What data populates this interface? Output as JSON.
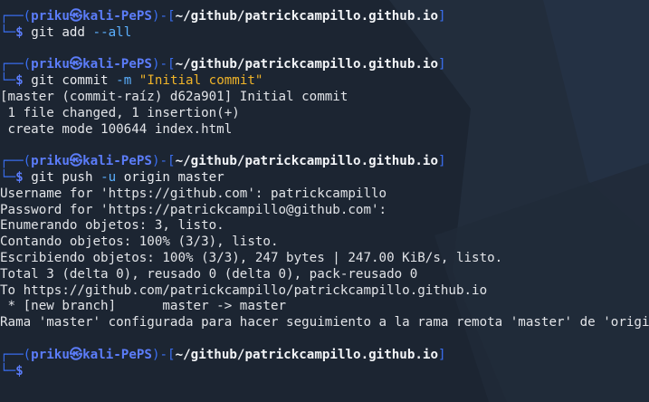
{
  "prompt": {
    "top_prefix": "┌──(",
    "bottom_prefix": "└─",
    "user": "priku",
    "at_symbol": "㉿",
    "host": "kali-PePS",
    "mid": ")-[",
    "path": "~/github/patrickcampillo.github.io",
    "close": "]",
    "dollar": "$"
  },
  "commands": [
    {
      "tokens": [
        {
          "text": "git add ",
          "kind": "cmd"
        },
        {
          "text": "--all",
          "kind": "flag"
        }
      ],
      "output": []
    },
    {
      "tokens": [
        {
          "text": "git commit ",
          "kind": "cmd"
        },
        {
          "text": "-m ",
          "kind": "flag"
        },
        {
          "text": "\"Initial commit\"",
          "kind": "str"
        }
      ],
      "output": [
        "[master (commit-raíz) d62a901] Initial commit",
        " 1 file changed, 1 insertion(+)",
        " create mode 100644 index.html"
      ]
    },
    {
      "tokens": [
        {
          "text": "git push ",
          "kind": "cmd"
        },
        {
          "text": "-u ",
          "kind": "flag"
        },
        {
          "text": "origin master",
          "kind": "cmd"
        }
      ],
      "output": [
        "Username for 'https://github.com': patrickcampillo",
        "Password for 'https://patrickcampillo@github.com':",
        "Enumerando objetos: 3, listo.",
        "Contando objetos: 100% (3/3), listo.",
        "Escribiendo objetos: 100% (3/3), 247 bytes | 247.00 KiB/s, listo.",
        "Total 3 (delta 0), reusado 0 (delta 0), pack-reusado 0",
        "To https://github.com/patrickcampillo/patrickcampillo.github.io",
        " * [new branch]      master -> master",
        "Rama 'master' configurada para hacer seguimiento a la rama remota 'master' de 'origin'."
      ]
    },
    {
      "tokens": [],
      "output": []
    }
  ]
}
